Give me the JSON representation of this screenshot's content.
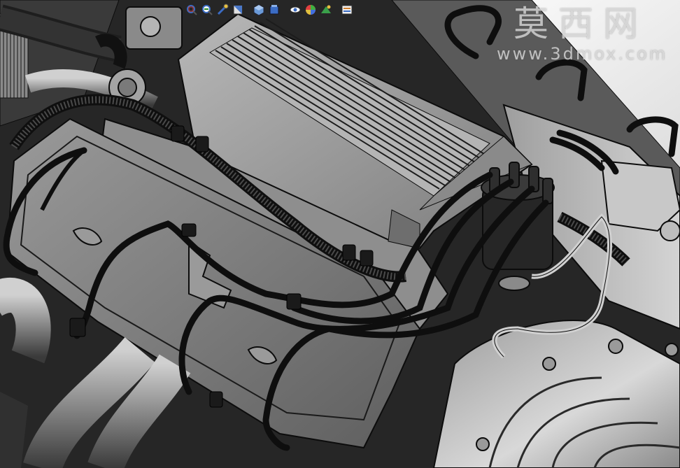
{
  "app": {
    "document": "engine assembly 3D model",
    "render_mode": "shaded-with-edges"
  },
  "toolbar": {
    "items": [
      {
        "name": "zoom-to-fit-icon"
      },
      {
        "name": "zoom-to-area-icon"
      },
      {
        "name": "previous-view-icon"
      },
      {
        "name": "section-view-icon"
      },
      {
        "name": "view-orientation-icon"
      },
      {
        "name": "display-style-icon"
      },
      {
        "name": "hide-show-items-icon"
      },
      {
        "name": "edit-appearance-icon"
      },
      {
        "name": "apply-scene-icon"
      },
      {
        "name": "view-settings-icon"
      }
    ]
  },
  "watermark": {
    "title": "莫西网",
    "url": "www.3dmox.com"
  },
  "colors": {
    "background_top": "#f4f4f4",
    "metal_light": "#a6a6a6",
    "metal_mid": "#7a7a7a",
    "metal_dark": "#4a4a4a",
    "hose": "#2a2a2a",
    "edge": "#0c0c0c"
  }
}
